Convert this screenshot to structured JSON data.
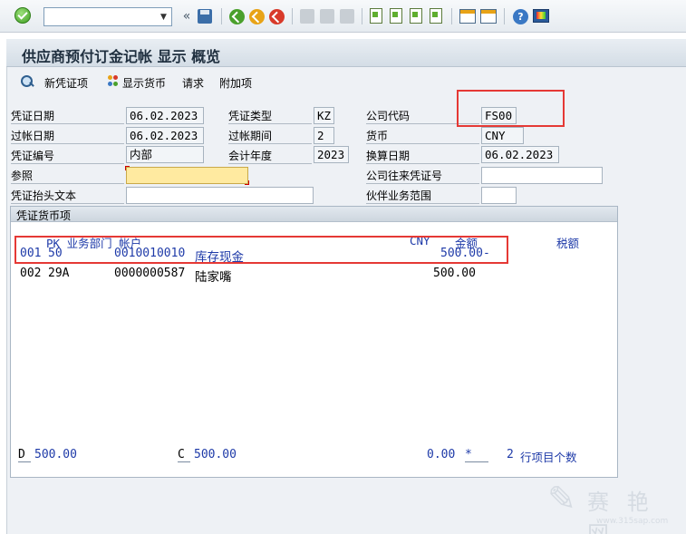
{
  "app": {
    "title": "供应商预付订金记帐 显示 概览"
  },
  "system_toolbar": {
    "command_field_value": "",
    "nav_glyph": "«"
  },
  "app_toolbar": {
    "new_item": "新凭证项",
    "show_currency": "显示货币",
    "request": "请求",
    "additional": "附加项"
  },
  "header": {
    "doc_date_label": "凭证日期",
    "doc_date": "06.02.2023",
    "posting_date_label": "过帐日期",
    "posting_date": "06.02.2023",
    "doc_number_label": "凭证编号",
    "doc_number": "内部",
    "reference_label": "参照",
    "reference": "",
    "header_text_label": "凭证抬头文本",
    "header_text": "",
    "doc_type_label": "凭证类型",
    "doc_type": "KZ",
    "period_label": "过帐期间",
    "period": "2",
    "fiscal_year_label": "会计年度",
    "fiscal_year": "2023",
    "company_code_label": "公司代码",
    "company_code": "FS00",
    "currency_label": "货币",
    "currency": "CNY",
    "translation_date_label": "换算日期",
    "translation_date": "06.02.2023",
    "intercompany_label": "公司往来凭证号",
    "intercompany": "",
    "partner_ba_label": "伙伴业务范围",
    "partner_ba": ""
  },
  "items": {
    "group_title": "凭证货币项",
    "col_pk_ba_account": "PK 业务部门 帐户",
    "col_currency": "CNY",
    "col_amount": "金额",
    "col_tax": "税额",
    "rows": [
      {
        "item": "001",
        "pk": "50",
        "account": "0010010010",
        "name": "库存现金",
        "amount": "500.00-"
      },
      {
        "item": "002",
        "pk": "29A",
        "account": "0000000587",
        "name": "陆家嘴",
        "amount": "500.00"
      }
    ],
    "footer": {
      "debit_label": "D",
      "debit": "500.00",
      "credit_label": "C",
      "credit": "500.00",
      "balance": "0.00",
      "balance_flag": "*",
      "count": "2",
      "count_label": "行项目个数"
    }
  },
  "watermark": {
    "name": "赛 艳 网",
    "url": "www.315sap.com"
  },
  "colors": {
    "accent_blue": "#1e3aa8",
    "highlight_red": "#e53935",
    "required_yellow": "#ffeaa0"
  },
  "icons": [
    "check-icon",
    "save-icon",
    "back-icon",
    "exit-icon",
    "cancel-icon",
    "print-icon",
    "find-icon",
    "find-next-icon",
    "first-page-icon",
    "previous-page-icon",
    "next-page-icon",
    "last-page-icon",
    "new-session-icon",
    "shortcut-icon",
    "help-icon",
    "layout-icon",
    "overview-icon",
    "currency-icon"
  ]
}
